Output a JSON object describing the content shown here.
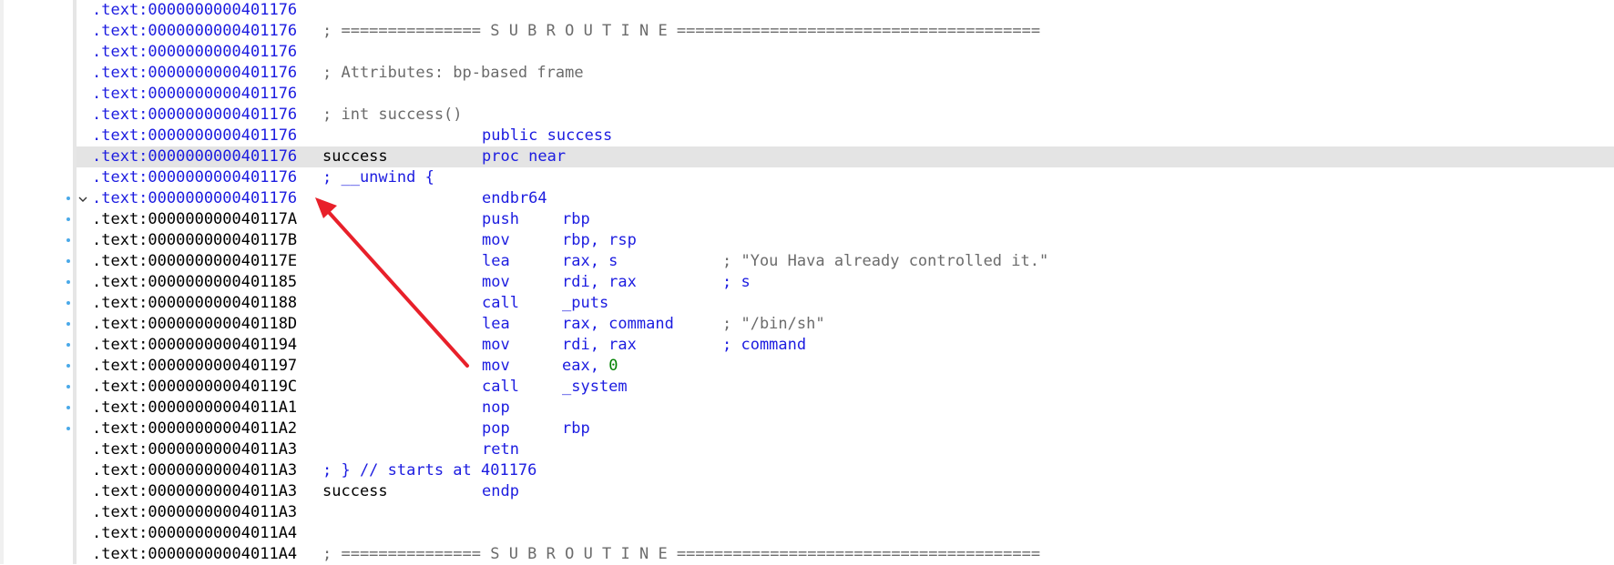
{
  "colors": {
    "address_code": "#1c1ce0",
    "address_data": "#000000",
    "comment": "#6b6b6b",
    "immediate": "#008000",
    "selected_row_bg": "#e4e4e4",
    "gutter_dot": "#4aa9e8",
    "annotation_arrow": "#e8202a"
  },
  "gutter": {
    "collapse_icon": "chevron-down-icon"
  },
  "listing": [
    {
      "addr": ".text:0000000000401176",
      "addr_color": "blue"
    },
    {
      "addr": ".text:0000000000401176",
      "addr_color": "blue",
      "header": "; =============== S U B R O U T I N E =======================================",
      "header_color": "gray"
    },
    {
      "addr": ".text:0000000000401176",
      "addr_color": "blue"
    },
    {
      "addr": ".text:0000000000401176",
      "addr_color": "blue",
      "header": "; Attributes: bp-based frame",
      "header_color": "gray"
    },
    {
      "addr": ".text:0000000000401176",
      "addr_color": "blue"
    },
    {
      "addr": ".text:0000000000401176",
      "addr_color": "blue",
      "header": "; int success()",
      "header_color": "gray"
    },
    {
      "addr": ".text:0000000000401176",
      "addr_color": "blue",
      "instr": "public success",
      "instr_color": "blue"
    },
    {
      "addr": ".text:0000000000401176",
      "addr_color": "blue",
      "label": "success",
      "instr": "proc near",
      "instr_color": "blue",
      "selected": true
    },
    {
      "addr": ".text:0000000000401176",
      "addr_color": "blue",
      "header": "; __unwind {",
      "header_color": "blue"
    },
    {
      "addr": ".text:0000000000401176",
      "addr_color": "blue",
      "instr": "endbr64",
      "instr_color": "blue",
      "dot": true,
      "chevron": true
    },
    {
      "addr": ".text:000000000040117A",
      "addr_color": "black",
      "instr": "push",
      "op": "rbp",
      "instr_color": "blue",
      "dot": true
    },
    {
      "addr": ".text:000000000040117B",
      "addr_color": "black",
      "instr": "mov",
      "op": "rbp, rsp",
      "instr_color": "blue",
      "dot": true
    },
    {
      "addr": ".text:000000000040117E",
      "addr_color": "black",
      "instr": "lea",
      "op": "rax, s",
      "instr_color": "blue",
      "comment": "; \"You Hava already controlled it.\"",
      "comment_color": "gray",
      "dot": true
    },
    {
      "addr": ".text:0000000000401185",
      "addr_color": "black",
      "instr": "mov",
      "op": "rdi, rax",
      "instr_color": "blue",
      "comment": "; s",
      "comment_color": "blue",
      "dot": true
    },
    {
      "addr": ".text:0000000000401188",
      "addr_color": "black",
      "instr": "call",
      "op": "_puts",
      "instr_color": "blue",
      "dot": true
    },
    {
      "addr": ".text:000000000040118D",
      "addr_color": "black",
      "instr": "lea",
      "op": "rax, command",
      "instr_color": "blue",
      "comment": "; \"/bin/sh\"",
      "comment_color": "gray",
      "dot": true
    },
    {
      "addr": ".text:0000000000401194",
      "addr_color": "black",
      "instr": "mov",
      "op": "rdi, rax",
      "instr_color": "blue",
      "comment": "; command",
      "comment_color": "blue",
      "dot": true
    },
    {
      "addr": ".text:0000000000401197",
      "addr_color": "black",
      "instr": "mov",
      "op": "eax,",
      "op_imm": "0",
      "instr_color": "blue",
      "dot": true
    },
    {
      "addr": ".text:000000000040119C",
      "addr_color": "black",
      "instr": "call",
      "op": "_system",
      "instr_color": "blue",
      "dot": true
    },
    {
      "addr": ".text:00000000004011A1",
      "addr_color": "black",
      "instr": "nop",
      "instr_color": "blue",
      "dot": true
    },
    {
      "addr": ".text:00000000004011A2",
      "addr_color": "black",
      "instr": "pop",
      "op": "rbp",
      "instr_color": "blue",
      "dot": true
    },
    {
      "addr": ".text:00000000004011A3",
      "addr_color": "black",
      "instr": "retn",
      "instr_color": "blue"
    },
    {
      "addr": ".text:00000000004011A3",
      "addr_color": "black",
      "header": "; } // starts at 401176",
      "header_color": "blue"
    },
    {
      "addr": ".text:00000000004011A3",
      "addr_color": "black",
      "label": "success",
      "instr": "endp",
      "instr_color": "blue"
    },
    {
      "addr": ".text:00000000004011A3",
      "addr_color": "black"
    },
    {
      "addr": ".text:00000000004011A4",
      "addr_color": "black"
    },
    {
      "addr": ".text:00000000004011A4",
      "addr_color": "black",
      "header": "; =============== S U B R O U T I N E =======================================",
      "header_color": "gray"
    }
  ]
}
